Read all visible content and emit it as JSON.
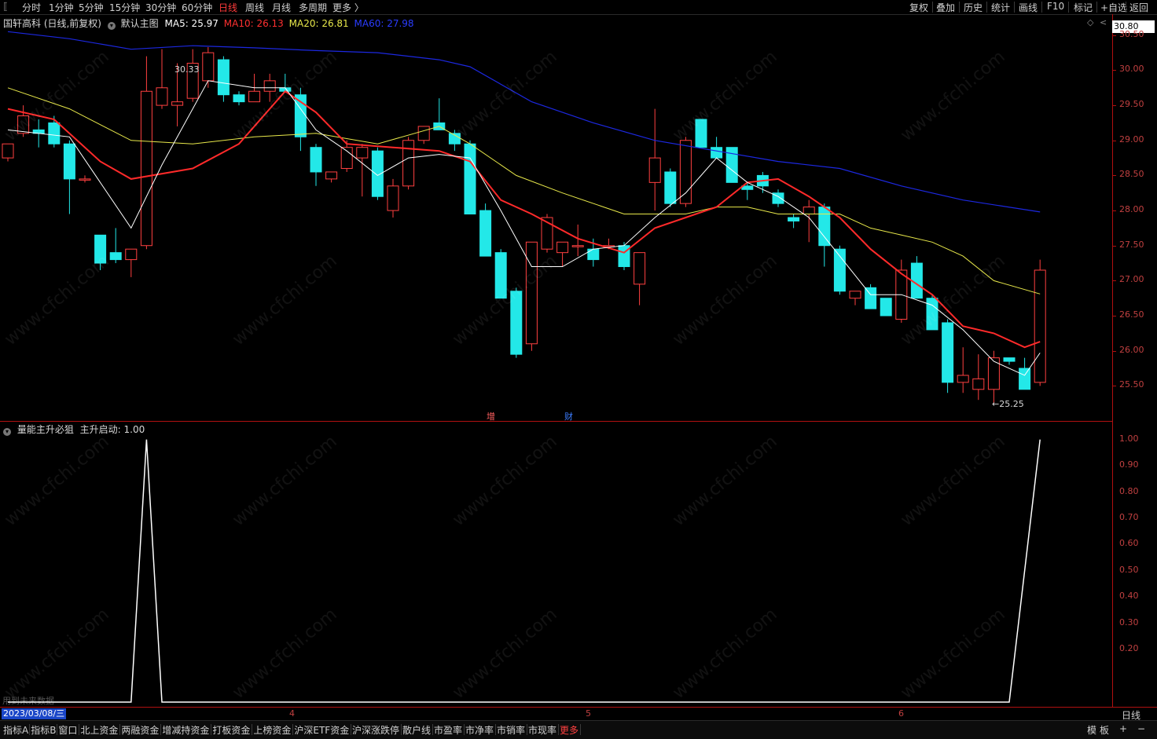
{
  "toolbar": {
    "left_tabs": [
      "分时",
      "1分钟",
      "5分钟",
      "15分钟",
      "30分钟",
      "60分钟",
      "日线",
      "周线",
      "月线",
      "多周期",
      "更多 〉"
    ],
    "active_tab": "日线",
    "right_buttons": [
      "复权",
      "叠加",
      "历史",
      "统计",
      "画线",
      "F10",
      "标记",
      "+自选",
      "返回"
    ]
  },
  "main_info": {
    "stock": "国轩高科 (日线,前复权)",
    "indicator": "默认主图",
    "ma5": "MA5: 25.97",
    "ma10": "MA10: 26.13",
    "ma20": "MA20: 26.81",
    "ma60": "MA60: 27.98",
    "colors": {
      "ma5": "#ffffff",
      "ma10": "#ff2a2a",
      "ma20": "#e8e84a",
      "ma60": "#1c28e0",
      "up": "#ff4040",
      "down": "#23e8e8"
    }
  },
  "sub_info": {
    "name": "量能主升必狙",
    "value": "主升启动: 1.00",
    "note": "用到未来数据"
  },
  "price_axis": {
    "current": "30.80",
    "ticks": [
      "30.50",
      "30.00",
      "29.50",
      "29.00",
      "28.50",
      "28.00",
      "27.50",
      "27.00",
      "26.50",
      "26.00",
      "25.50"
    ]
  },
  "sub_axis": {
    "ticks": [
      "1.00",
      "0.90",
      "0.80",
      "0.70",
      "0.60",
      "0.50",
      "0.40",
      "0.30",
      "0.20"
    ]
  },
  "annotations": {
    "high": "30.33",
    "low": "←25.25",
    "marker1": "增",
    "marker2": "财"
  },
  "x_axis": {
    "date": "2023/03/08/三",
    "months": [
      "4",
      "5",
      "6"
    ],
    "period": "日线"
  },
  "bottom_tabs": [
    "指标A",
    "指标B",
    "窗口",
    "北上资金",
    "两融资金",
    "增减持资金",
    "打板资金",
    "上榜资金",
    "沪深ETF资金",
    "沪深涨跌停",
    "散户线",
    "市盈率",
    "市净率",
    "市销率",
    "市现率",
    "更多"
  ],
  "bottom_right": [
    "模",
    "板",
    "+",
    "−"
  ],
  "watermark": "www.cfchi.com",
  "chart_data": {
    "type": "candlestick",
    "candles": [
      {
        "o": 28.75,
        "h": 28.95,
        "l": 28.7,
        "c": 28.95
      },
      {
        "o": 29.1,
        "h": 29.5,
        "l": 29.05,
        "c": 29.35
      },
      {
        "o": 29.15,
        "h": 29.3,
        "l": 28.9,
        "c": 29.1
      },
      {
        "o": 29.25,
        "h": 29.35,
        "l": 28.9,
        "c": 28.95
      },
      {
        "o": 28.95,
        "h": 29.0,
        "l": 27.95,
        "c": 28.45
      },
      {
        "o": 28.45,
        "h": 28.5,
        "l": 28.4,
        "c": 28.45
      },
      {
        "o": 27.65,
        "h": 27.65,
        "l": 27.15,
        "c": 27.25
      },
      {
        "o": 27.4,
        "h": 27.75,
        "l": 27.25,
        "c": 27.3
      },
      {
        "o": 27.3,
        "h": 27.45,
        "l": 27.05,
        "c": 27.45
      },
      {
        "o": 27.5,
        "h": 30.2,
        "l": 27.45,
        "c": 29.7
      },
      {
        "o": 29.5,
        "h": 30.3,
        "l": 29.45,
        "c": 29.75
      },
      {
        "o": 29.5,
        "h": 30.1,
        "l": 29.2,
        "c": 29.55
      },
      {
        "o": 29.6,
        "h": 30.3,
        "l": 29.55,
        "c": 30.1
      },
      {
        "o": 29.85,
        "h": 30.33,
        "l": 29.75,
        "c": 30.25
      },
      {
        "o": 30.15,
        "h": 30.2,
        "l": 29.55,
        "c": 29.65
      },
      {
        "o": 29.65,
        "h": 29.7,
        "l": 29.5,
        "c": 29.55
      },
      {
        "o": 29.55,
        "h": 29.95,
        "l": 29.55,
        "c": 29.7
      },
      {
        "o": 29.7,
        "h": 29.95,
        "l": 29.55,
        "c": 29.85
      },
      {
        "o": 29.75,
        "h": 29.95,
        "l": 29.7,
        "c": 29.7
      },
      {
        "o": 29.65,
        "h": 29.75,
        "l": 28.85,
        "c": 29.05
      },
      {
        "o": 28.9,
        "h": 28.95,
        "l": 28.35,
        "c": 28.55
      },
      {
        "o": 28.45,
        "h": 28.5,
        "l": 28.4,
        "c": 28.55
      },
      {
        "o": 28.6,
        "h": 29.0,
        "l": 28.55,
        "c": 28.9
      },
      {
        "o": 28.75,
        "h": 28.95,
        "l": 28.2,
        "c": 28.9
      },
      {
        "o": 28.85,
        "h": 28.9,
        "l": 28.15,
        "c": 28.2
      },
      {
        "o": 28.0,
        "h": 28.45,
        "l": 27.9,
        "c": 28.35
      },
      {
        "o": 28.35,
        "h": 29.05,
        "l": 28.3,
        "c": 29.0
      },
      {
        "o": 29.0,
        "h": 29.15,
        "l": 28.95,
        "c": 29.2
      },
      {
        "o": 29.25,
        "h": 29.6,
        "l": 29.2,
        "c": 29.15
      },
      {
        "o": 29.1,
        "h": 29.15,
        "l": 28.85,
        "c": 28.95
      },
      {
        "o": 28.95,
        "h": 29.0,
        "l": 27.95,
        "c": 27.95
      },
      {
        "o": 28.0,
        "h": 28.1,
        "l": 27.35,
        "c": 27.35
      },
      {
        "o": 27.4,
        "h": 27.45,
        "l": 26.75,
        "c": 26.75
      },
      {
        "o": 26.85,
        "h": 26.9,
        "l": 25.9,
        "c": 25.95
      },
      {
        "o": 26.1,
        "h": 27.55,
        "l": 26.0,
        "c": 27.55
      },
      {
        "o": 27.45,
        "h": 27.95,
        "l": 27.4,
        "c": 27.9
      },
      {
        "o": 27.4,
        "h": 27.5,
        "l": 27.2,
        "c": 27.55
      },
      {
        "o": 27.5,
        "h": 27.8,
        "l": 27.35,
        "c": 27.5
      },
      {
        "o": 27.45,
        "h": 27.6,
        "l": 27.2,
        "c": 27.3
      },
      {
        "o": 27.5,
        "h": 27.6,
        "l": 27.45,
        "c": 27.5
      },
      {
        "o": 27.5,
        "h": 27.55,
        "l": 27.15,
        "c": 27.2
      },
      {
        "o": 26.95,
        "h": 27.4,
        "l": 26.65,
        "c": 27.4
      },
      {
        "o": 28.4,
        "h": 29.45,
        "l": 28.0,
        "c": 28.75
      },
      {
        "o": 28.55,
        "h": 28.6,
        "l": 28.05,
        "c": 28.1
      },
      {
        "o": 28.1,
        "h": 29.05,
        "l": 28.05,
        "c": 29.0
      },
      {
        "o": 29.3,
        "h": 29.3,
        "l": 28.9,
        "c": 28.9
      },
      {
        "o": 28.9,
        "h": 29.05,
        "l": 28.8,
        "c": 28.75
      },
      {
        "o": 28.9,
        "h": 28.9,
        "l": 28.45,
        "c": 28.4
      },
      {
        "o": 28.35,
        "h": 28.4,
        "l": 28.15,
        "c": 28.3
      },
      {
        "o": 28.5,
        "h": 28.55,
        "l": 28.25,
        "c": 28.35
      },
      {
        "o": 28.25,
        "h": 28.3,
        "l": 28.05,
        "c": 28.1
      },
      {
        "o": 27.9,
        "h": 27.95,
        "l": 27.75,
        "c": 27.85
      },
      {
        "o": 27.95,
        "h": 28.15,
        "l": 27.55,
        "c": 28.05
      },
      {
        "o": 28.05,
        "h": 28.1,
        "l": 27.2,
        "c": 27.5
      },
      {
        "o": 27.45,
        "h": 27.5,
        "l": 26.8,
        "c": 26.85
      },
      {
        "o": 26.75,
        "h": 26.85,
        "l": 26.65,
        "c": 26.85
      },
      {
        "o": 26.9,
        "h": 26.95,
        "l": 26.6,
        "c": 26.6
      },
      {
        "o": 26.75,
        "h": 26.75,
        "l": 26.5,
        "c": 26.5
      },
      {
        "o": 26.45,
        "h": 27.3,
        "l": 26.4,
        "c": 27.15
      },
      {
        "o": 27.25,
        "h": 27.35,
        "l": 26.75,
        "c": 26.75
      },
      {
        "o": 26.75,
        "h": 26.8,
        "l": 26.3,
        "c": 26.3
      },
      {
        "o": 26.4,
        "h": 26.45,
        "l": 25.4,
        "c": 25.55
      },
      {
        "o": 25.55,
        "h": 26.05,
        "l": 25.4,
        "c": 25.65
      },
      {
        "o": 25.45,
        "h": 25.95,
        "l": 25.3,
        "c": 25.6
      },
      {
        "o": 25.45,
        "h": 26.0,
        "l": 25.25,
        "c": 25.9
      },
      {
        "o": 25.9,
        "h": 25.9,
        "l": 25.8,
        "c": 25.85
      },
      {
        "o": 25.75,
        "h": 25.9,
        "l": 25.45,
        "c": 25.45
      },
      {
        "o": 25.55,
        "h": 27.3,
        "l": 25.5,
        "c": 27.15
      }
    ],
    "ma_lines": {
      "ma5": [
        [
          0,
          29.15
        ],
        [
          4,
          29.05
        ],
        [
          8,
          27.75
        ],
        [
          10,
          28.65
        ],
        [
          13,
          29.85
        ],
        [
          16,
          29.75
        ],
        [
          18,
          29.75
        ],
        [
          20,
          29.15
        ],
        [
          22,
          28.85
        ],
        [
          24,
          28.5
        ],
        [
          26,
          28.75
        ],
        [
          28,
          28.8
        ],
        [
          30,
          28.75
        ],
        [
          32,
          28.0
        ],
        [
          34,
          27.2
        ],
        [
          36,
          27.2
        ],
        [
          38,
          27.45
        ],
        [
          40,
          27.5
        ],
        [
          42,
          27.9
        ],
        [
          44,
          28.25
        ],
        [
          46,
          28.75
        ],
        [
          48,
          28.4
        ],
        [
          50,
          28.2
        ],
        [
          52,
          27.9
        ],
        [
          54,
          27.35
        ],
        [
          56,
          26.8
        ],
        [
          58,
          26.8
        ],
        [
          60,
          26.65
        ],
        [
          62,
          26.3
        ],
        [
          64,
          25.85
        ],
        [
          66,
          25.65
        ],
        [
          67,
          25.97
        ]
      ],
      "ma10": [
        [
          0,
          29.45
        ],
        [
          3,
          29.3
        ],
        [
          6,
          28.7
        ],
        [
          8,
          28.45
        ],
        [
          12,
          28.6
        ],
        [
          15,
          28.95
        ],
        [
          18,
          29.7
        ],
        [
          20,
          29.4
        ],
        [
          22,
          28.95
        ],
        [
          25,
          28.9
        ],
        [
          28,
          28.85
        ],
        [
          30,
          28.7
        ],
        [
          32,
          28.15
        ],
        [
          34,
          27.95
        ],
        [
          37,
          27.6
        ],
        [
          40,
          27.4
        ],
        [
          42,
          27.75
        ],
        [
          44,
          27.9
        ],
        [
          46,
          28.05
        ],
        [
          48,
          28.4
        ],
        [
          50,
          28.45
        ],
        [
          52,
          28.2
        ],
        [
          54,
          27.9
        ],
        [
          56,
          27.45
        ],
        [
          58,
          27.1
        ],
        [
          60,
          26.8
        ],
        [
          62,
          26.35
        ],
        [
          64,
          26.25
        ],
        [
          66,
          26.05
        ],
        [
          67,
          26.13
        ]
      ],
      "ma20": [
        [
          0,
          29.75
        ],
        [
          4,
          29.45
        ],
        [
          8,
          29.0
        ],
        [
          12,
          28.95
        ],
        [
          16,
          29.05
        ],
        [
          20,
          29.1
        ],
        [
          24,
          28.95
        ],
        [
          28,
          29.2
        ],
        [
          30,
          28.95
        ],
        [
          33,
          28.5
        ],
        [
          36,
          28.25
        ],
        [
          40,
          27.95
        ],
        [
          44,
          27.95
        ],
        [
          46,
          28.05
        ],
        [
          48,
          28.05
        ],
        [
          50,
          27.95
        ],
        [
          52,
          27.95
        ],
        [
          54,
          27.95
        ],
        [
          56,
          27.75
        ],
        [
          58,
          27.65
        ],
        [
          60,
          27.55
        ],
        [
          62,
          27.35
        ],
        [
          64,
          27.0
        ],
        [
          67,
          26.81
        ]
      ],
      "ma60": [
        [
          0,
          30.55
        ],
        [
          4,
          30.45
        ],
        [
          8,
          30.3
        ],
        [
          12,
          30.35
        ],
        [
          16,
          30.32
        ],
        [
          20,
          30.28
        ],
        [
          24,
          30.25
        ],
        [
          28,
          30.15
        ],
        [
          30,
          30.05
        ],
        [
          34,
          29.55
        ],
        [
          38,
          29.25
        ],
        [
          42,
          29.0
        ],
        [
          46,
          28.85
        ],
        [
          50,
          28.7
        ],
        [
          54,
          28.6
        ],
        [
          58,
          28.35
        ],
        [
          62,
          28.15
        ],
        [
          67,
          27.98
        ]
      ]
    },
    "sub_series": {
      "name": "主升启动",
      "values": [
        [
          0,
          0
        ],
        [
          8,
          0
        ],
        [
          9,
          1
        ],
        [
          10,
          0
        ],
        [
          65,
          0
        ],
        [
          67,
          1
        ]
      ]
    },
    "price_range": [
      25.0,
      30.8
    ],
    "sub_range": [
      0,
      1.05
    ]
  }
}
